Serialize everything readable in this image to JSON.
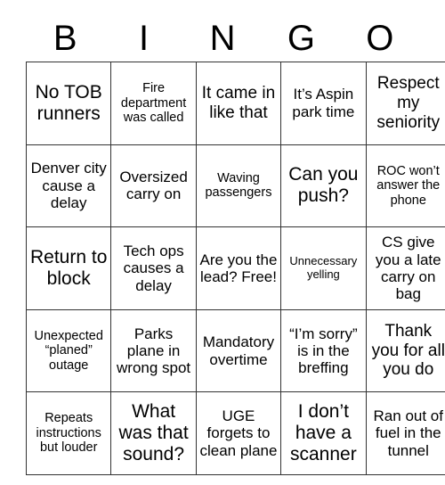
{
  "card": {
    "headers": [
      "B",
      "I",
      "N",
      "G",
      "O"
    ],
    "rows": [
      [
        {
          "text": "No TOB runners",
          "size": "sz-xl"
        },
        {
          "text": "Fire department was called",
          "size": "sz-sm"
        },
        {
          "text": "It came in like that",
          "size": "sz-lg"
        },
        {
          "text": "It’s Aspin park time",
          "size": "sz-md"
        },
        {
          "text": "Respect my seniority",
          "size": "sz-lg"
        }
      ],
      [
        {
          "text": "Denver city cause a delay",
          "size": "sz-md"
        },
        {
          "text": "Oversized carry on",
          "size": "sz-md"
        },
        {
          "text": "Waving passengers",
          "size": "sz-sm"
        },
        {
          "text": "Can you push?",
          "size": "sz-xl"
        },
        {
          "text": "ROC won’t answer the phone",
          "size": "sz-sm"
        }
      ],
      [
        {
          "text": "Return to block",
          "size": "sz-xl"
        },
        {
          "text": "Tech ops causes a delay",
          "size": "sz-md"
        },
        {
          "text": "Are you the lead? Free!",
          "size": "sz-md"
        },
        {
          "text": "Unnecessary yelling",
          "size": "sz-xs"
        },
        {
          "text": "CS give you a late carry on bag",
          "size": "sz-md"
        }
      ],
      [
        {
          "text": "Unexpected “planed” outage",
          "size": "sz-sm"
        },
        {
          "text": "Parks plane in wrong spot",
          "size": "sz-md"
        },
        {
          "text": "Mandatory overtime",
          "size": "sz-md"
        },
        {
          "text": "“I’m sorry” is in the breffing",
          "size": "sz-md"
        },
        {
          "text": "Thank you for all you do",
          "size": "sz-lg"
        }
      ],
      [
        {
          "text": "Repeats instructions but louder",
          "size": "sz-sm"
        },
        {
          "text": "What was that sound?",
          "size": "sz-xl"
        },
        {
          "text": "UGE forgets to clean plane",
          "size": "sz-md"
        },
        {
          "text": "I don’t have a scanner",
          "size": "sz-xl"
        },
        {
          "text": "Ran out of fuel in the tunnel",
          "size": "sz-md"
        }
      ]
    ]
  }
}
